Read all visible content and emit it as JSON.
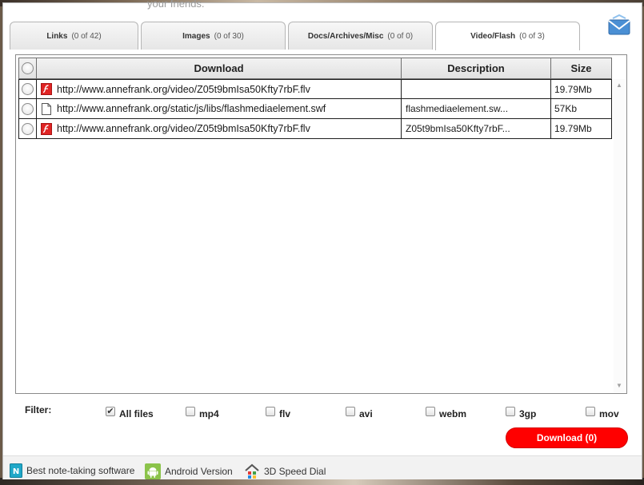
{
  "ghost_text": "your friends.",
  "tabs": [
    {
      "label": "Links",
      "count": "(0 of 42)"
    },
    {
      "label": "Images",
      "count": "(0 of 30)"
    },
    {
      "label": "Docs/Archives/Misc",
      "count": "(0 of 0)"
    },
    {
      "label": "Video/Flash",
      "count": "(0 of 3)",
      "active": true
    }
  ],
  "table": {
    "headers": {
      "download": "Download",
      "description": "Description",
      "size": "Size"
    },
    "rows": [
      {
        "url": "http://www.annefrank.org/video/Z05t9bmIsa50Kfty7rbF.flv",
        "description": "",
        "size": "19.79Mb",
        "icon": "flash-file-icon"
      },
      {
        "url": "http://www.annefrank.org/static/js/libs/flashmediaelement.swf",
        "description": "flashmediaelement.sw...",
        "size": "57Kb",
        "icon": "generic-file-icon"
      },
      {
        "url": "http://www.annefrank.org/video/Z05t9bmIsa50Kfty7rbF.flv",
        "description": "Z05t9bmIsa50Kfty7rbF...",
        "size": "19.79Mb",
        "icon": "flash-file-icon"
      }
    ]
  },
  "filter": {
    "label": "Filter:",
    "options": [
      {
        "label": "All files",
        "checked": true
      },
      {
        "label": "mp4",
        "checked": false
      },
      {
        "label": "flv",
        "checked": false
      },
      {
        "label": "avi",
        "checked": false
      },
      {
        "label": "webm",
        "checked": false
      },
      {
        "label": "3gp",
        "checked": false
      },
      {
        "label": "mov",
        "checked": false
      }
    ]
  },
  "download_button": "Download (0)",
  "footer": {
    "links": [
      {
        "label": "Best note-taking software",
        "icon": "notes-app-icon"
      },
      {
        "label": "Android Version",
        "icon": "android-icon"
      },
      {
        "label": "3D Speed Dial",
        "icon": "speed-dial-icon"
      }
    ]
  },
  "colors": {
    "download_button": "#ff0000",
    "flash_icon": "#e02424",
    "android_icon": "#8bc34a"
  }
}
